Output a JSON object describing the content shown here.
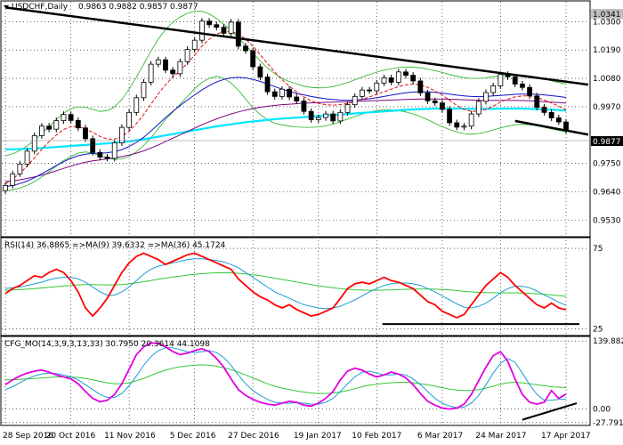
{
  "colors": {
    "candle_up": "#ffffff",
    "candle_down": "#000000",
    "bollinger": "#1db31d",
    "ma_red": "#e01010",
    "ma_blue": "#1010cc",
    "ma_purple": "#800080",
    "ma_cyan": "#00e5ff",
    "trendline": "#000000",
    "rsi_line": "#ff0000",
    "rsi_ma_fast": "#1e9bd6",
    "rsi_ma_slow": "#33c733",
    "cfg_main": "#e000e0",
    "cfg_signal1": "#1e9bd6",
    "cfg_signal2": "#33c733",
    "price_tag_bg": "#000000",
    "price_tag_fg": "#ffffff",
    "top_tag_bg": "#c0c0c0"
  },
  "header": {
    "symbol": "USDCHF,Daily",
    "ohlc": "0.9863 0.9882 0.9857 0.9877"
  },
  "price_axis": {
    "current_price": "0.9877",
    "top_marker": "1.0341",
    "ticks": [
      "1.0300",
      "1.0190",
      "1.0080",
      "0.9970",
      "0.9750",
      "0.9640",
      "0.9530"
    ]
  },
  "rsi_panel": {
    "label": "RSI(14) 36.8865 =>MA(9) 39.6332 =>MA(36) 45.1724",
    "ticks": [
      "75",
      "25"
    ]
  },
  "cfg_panel": {
    "label": "CFG_MO(14,3,9,3,13,33) 30.7950 20.3614 44.1098",
    "ticks": [
      "139.8827",
      "0.00",
      "-27.7916"
    ]
  },
  "time_axis": {
    "labels": [
      "28 Sep 2016",
      "20 Oct 2016",
      "11 Nov 2016",
      "5 Dec 2016",
      "27 Dec 2016",
      "19 Jan 2017",
      "10 Feb 2017",
      "6 Mar 2017",
      "24 Mar 2017",
      "17 Apr 2017"
    ]
  },
  "chart_data": [
    {
      "type": "candlestick",
      "title": "USDCHF,Daily",
      "ylim": [
        0.948,
        1.037
      ],
      "closes": [
        0.9665,
        0.971,
        0.9748,
        0.9798,
        0.9858,
        0.9895,
        0.9883,
        0.9916,
        0.994,
        0.9917,
        0.9888,
        0.9846,
        0.9793,
        0.9775,
        0.977,
        0.983,
        0.989,
        0.9948,
        1.0005,
        1.0065,
        1.0135,
        1.0152,
        1.0112,
        1.0098,
        1.0145,
        1.0192,
        1.0228,
        1.0302,
        1.0288,
        1.0278,
        1.0255,
        1.0298,
        1.0205,
        1.0187,
        1.0125,
        1.0085,
        1.0028,
        1.001,
        1.0038,
        1.0008,
        0.9992,
        0.9952,
        0.992,
        0.9928,
        0.9942,
        0.9915,
        0.9948,
        0.9978,
        1.001,
        1.0035,
        1.0032,
        1.0062,
        1.0082,
        1.0065,
        1.0105,
        1.0092,
        1.007,
        1.0024,
        0.9993,
        0.9985,
        0.996,
        0.9908,
        0.9891,
        0.9895,
        0.9942,
        0.9991,
        1.0025,
        1.0051,
        1.0095,
        1.0086,
        1.0058,
        1.0045,
        1.0012,
        0.9968,
        0.9948,
        0.9927,
        0.9911,
        0.9877
      ],
      "lower_band": [
        0.9645,
        0.9648,
        0.9655,
        0.9665,
        0.968,
        0.9698,
        0.9718,
        0.974,
        0.9762,
        0.9778,
        0.979,
        0.9795,
        0.979,
        0.978,
        0.977,
        0.9766,
        0.9768,
        0.9778,
        0.9795,
        0.982,
        0.985,
        0.9885,
        0.992,
        0.995,
        0.998,
        1.001,
        1.004,
        1.0065,
        1.008,
        1.0088,
        1.008,
        1.0062,
        1.0034,
        1.0,
        0.9966,
        0.994,
        0.992,
        0.9906,
        0.99,
        0.9895,
        0.9892,
        0.989,
        0.989,
        0.9892,
        0.9896,
        0.9903,
        0.9912,
        0.9922,
        0.9932,
        0.9942,
        0.995,
        0.9955,
        0.9958,
        0.9958,
        0.9955,
        0.995,
        0.9942,
        0.9932,
        0.992,
        0.9906,
        0.9893,
        0.9882,
        0.9872,
        0.9866,
        0.9864,
        0.9866,
        0.9872,
        0.988,
        0.9888,
        0.9895,
        0.99,
        0.9902,
        0.99,
        0.9896,
        0.989,
        0.9884,
        0.9878,
        0.9873
      ],
      "upper_band": [
        0.978,
        0.9788,
        0.98,
        0.9818,
        0.984,
        0.9866,
        0.9893,
        0.992,
        0.9945,
        0.9962,
        0.997,
        0.9968,
        0.996,
        0.9952,
        0.9955,
        0.997,
        0.9998,
        1.0038,
        1.0085,
        1.0135,
        1.0185,
        1.0232,
        1.027,
        1.0298,
        1.0318,
        1.0332,
        1.0341,
        1.034,
        1.033,
        1.0312,
        1.029,
        1.0265,
        1.0238,
        1.0208,
        1.0178,
        1.0148,
        1.012,
        1.0098,
        1.008,
        1.0068,
        1.0058,
        1.005,
        1.0045,
        1.0043,
        1.0044,
        1.0048,
        1.0055,
        1.0064,
        1.0074,
        1.0085,
        1.0095,
        1.0104,
        1.0112,
        1.0118,
        1.0122,
        1.0124,
        1.0124,
        1.0121,
        1.0116,
        1.011,
        1.0103,
        1.0095,
        1.0088,
        1.0083,
        1.008,
        1.008,
        1.0082,
        1.0086,
        1.009,
        1.0093,
        1.0094,
        1.0093,
        1.009,
        1.0085,
        1.0078,
        1.0071,
        1.0064,
        1.0058
      ],
      "ma_red": [
        0.967,
        0.969,
        0.9712,
        0.974,
        0.9772,
        0.9805,
        0.9835,
        0.986,
        0.9882,
        0.9893,
        0.9893,
        0.9885,
        0.987,
        0.9855,
        0.9845,
        0.9845,
        0.9855,
        0.9875,
        0.9905,
        0.994,
        0.998,
        1.002,
        1.0055,
        1.0085,
        1.011,
        1.0138,
        1.017,
        1.0205,
        1.0232,
        1.0252,
        1.0262,
        1.0262,
        1.0252,
        1.0232,
        1.0205,
        1.0172,
        1.0138,
        1.0105,
        1.0075,
        1.005,
        1.0028,
        1.0008,
        0.9993,
        0.9983,
        0.9978,
        0.9976,
        0.9978,
        0.9983,
        0.999,
        0.9998,
        1.0008,
        1.0018,
        1.0028,
        1.0038,
        1.0048,
        1.0055,
        1.0058,
        1.0055,
        1.0045,
        1.0032,
        1.0015,
        0.9995,
        0.9975,
        0.996,
        0.9952,
        0.9953,
        0.996,
        0.9972,
        0.9988,
        1.0,
        1.0008,
        1.0012,
        1.0012,
        1.0006,
        0.9996,
        0.9985,
        0.9972,
        0.9958
      ],
      "ma_blue": [
        0.966,
        0.9665,
        0.9672,
        0.9682,
        0.9695,
        0.971,
        0.9726,
        0.9742,
        0.9757,
        0.977,
        0.978,
        0.9786,
        0.9789,
        0.979,
        0.9792,
        0.9796,
        0.9804,
        0.9816,
        0.9832,
        0.9852,
        0.9876,
        0.9902,
        0.9928,
        0.9952,
        0.9975,
        0.9996,
        1.0016,
        1.0035,
        1.0052,
        1.0066,
        1.0076,
        1.0082,
        1.0084,
        1.0082,
        1.0076,
        1.0068,
        1.0058,
        1.0048,
        1.0038,
        1.003,
        1.0022,
        1.0016,
        1.001,
        1.0005,
        1.0001,
        0.9998,
        0.9996,
        0.9995,
        0.9996,
        0.9998,
        1.0001,
        1.0005,
        1.001,
        1.0015,
        1.002,
        1.0024,
        1.0027,
        1.0028,
        1.0028,
        1.0026,
        1.0023,
        1.0019,
        1.0015,
        1.0012,
        1.001,
        1.0009,
        1.001,
        1.0012,
        1.0014,
        1.0016,
        1.0018,
        1.0019,
        1.0019,
        1.0018,
        1.0016,
        1.0013,
        1.001,
        1.0006
      ],
      "ma_purple": [
        0.968,
        0.9683,
        0.9687,
        0.9692,
        0.9698,
        0.9705,
        0.9713,
        0.9722,
        0.9731,
        0.974,
        0.9748,
        0.9755,
        0.976,
        0.9764,
        0.9768,
        0.9772,
        0.9777,
        0.9783,
        0.979,
        0.9799,
        0.981,
        0.9822,
        0.9835,
        0.9848,
        0.9861,
        0.9874,
        0.9887,
        0.99,
        0.9912,
        0.9923,
        0.9933,
        0.9942,
        0.995,
        0.9957,
        0.9963,
        0.9968,
        0.9972,
        0.9975,
        0.9978,
        0.998,
        0.9982,
        0.9984,
        0.9985,
        0.9986,
        0.9987,
        0.9988,
        0.9989,
        0.999,
        0.9991,
        0.9992,
        0.9993,
        0.9994,
        0.9995,
        0.9996,
        0.9997,
        0.9998,
        0.9999,
        1.0,
        1.0,
        1.0,
        1.0,
        0.9999,
        0.9998,
        0.9997,
        0.9996,
        0.9995,
        0.9995,
        0.9995,
        0.9995,
        0.9995,
        0.9995,
        0.9994,
        0.9993,
        0.9992,
        0.999,
        0.9988,
        0.9986,
        0.9984
      ],
      "ma_cyan": [
        0.9805,
        0.9805,
        0.9806,
        0.9807,
        0.9808,
        0.981,
        0.9812,
        0.9814,
        0.9816,
        0.9818,
        0.982,
        0.9822,
        0.9824,
        0.9826,
        0.9828,
        0.983,
        0.9833,
        0.9836,
        0.984,
        0.9844,
        0.9849,
        0.9854,
        0.9859,
        0.9864,
        0.9869,
        0.9874,
        0.9879,
        0.9884,
        0.9889,
        0.9894,
        0.9898,
        0.9902,
        0.9906,
        0.991,
        0.9913,
        0.9916,
        0.9919,
        0.9922,
        0.9924,
        0.9926,
        0.9928,
        0.993,
        0.9932,
        0.9934,
        0.9936,
        0.9938,
        0.994,
        0.9942,
        0.9944,
        0.9946,
        0.9948,
        0.995,
        0.9952,
        0.9954,
        0.9956,
        0.9958,
        0.996,
        0.9961,
        0.9962,
        0.9963,
        0.9963,
        0.9963,
        0.9963,
        0.9962,
        0.9962,
        0.9962,
        0.9962,
        0.9962,
        0.9963,
        0.9963,
        0.9963,
        0.9963,
        0.9962,
        0.9961,
        0.996,
        0.9959,
        0.9957,
        0.9955
      ],
      "trendlines": [
        {
          "name": "resistance",
          "from": [
            0,
            1.0355
          ],
          "to": [
            77,
            1.0035
          ]
        },
        {
          "name": "support",
          "from": [
            70,
            0.9915
          ],
          "to": [
            77,
            0.9862
          ]
        }
      ]
    },
    {
      "type": "line",
      "title": "RSI(14) 36.8865 =>MA(9) 39.6332 =>MA(36) 45.1724",
      "ylim": [
        22,
        80
      ],
      "ticks": [
        75,
        25
      ],
      "series": [
        {
          "name": "RSI(14)",
          "values": [
            47,
            50,
            52,
            55,
            58,
            57,
            60,
            62,
            60,
            55,
            48,
            38,
            33,
            38,
            44,
            52,
            60,
            66,
            70,
            72,
            70,
            68,
            65,
            67,
            69,
            71,
            72,
            70,
            68,
            66,
            64,
            62,
            56,
            52,
            48,
            45,
            43,
            40,
            38,
            40,
            37,
            35,
            33,
            34,
            36,
            38,
            44,
            50,
            53,
            54,
            53,
            55,
            57,
            55,
            54,
            52,
            50,
            46,
            42,
            40,
            36,
            34,
            32,
            34,
            40,
            46,
            52,
            56,
            60,
            57,
            52,
            48,
            44,
            40,
            38,
            41,
            38,
            36.9
          ]
        },
        {
          "name": "MA(9)",
          "values": [
            50,
            50.5,
            51,
            52,
            53,
            54,
            55.5,
            56.5,
            57,
            57,
            56,
            54,
            51,
            48,
            46,
            46,
            48,
            51,
            55,
            59,
            62,
            64,
            65,
            66,
            67,
            68,
            68.5,
            68.5,
            68,
            67.5,
            66.5,
            65,
            63,
            60,
            57,
            54,
            51,
            48,
            46,
            44,
            42,
            40,
            39,
            38,
            37.5,
            38,
            39,
            41,
            43,
            45.5,
            48,
            50,
            52,
            53,
            53.5,
            53.5,
            53,
            52,
            50,
            48,
            45.5,
            43,
            40.5,
            38.5,
            38,
            39,
            41,
            44,
            47.5,
            50,
            51.5,
            51.5,
            50.5,
            48.5,
            46,
            44,
            41.5,
            39.6
          ]
        },
        {
          "name": "MA(36)",
          "values": [
            49,
            49.2,
            49.4,
            49.7,
            50,
            50.4,
            50.8,
            51.2,
            51.6,
            52,
            52.3,
            52.5,
            52.5,
            52.4,
            52.3,
            52.3,
            52.5,
            53,
            53.6,
            54.3,
            55,
            55.8,
            56.5,
            57.2,
            57.8,
            58.4,
            58.9,
            59.3,
            59.6,
            59.8,
            59.9,
            59.8,
            59.5,
            59.1,
            58.6,
            58,
            57.3,
            56.5,
            55.7,
            54.9,
            54.1,
            53.3,
            52.5,
            51.8,
            51.1,
            50.5,
            50,
            49.6,
            49.3,
            49.1,
            49,
            49,
            49.1,
            49.2,
            49.4,
            49.6,
            49.7,
            49.8,
            49.8,
            49.7,
            49.5,
            49.2,
            48.8,
            48.4,
            48,
            47.7,
            47.5,
            47.4,
            47.4,
            47.4,
            47.4,
            47.3,
            47.1,
            46.8,
            46.5,
            46.1,
            45.7,
            45.2
          ]
        }
      ],
      "support_line": {
        "from": [
          53,
          28
        ],
        "to": [
          77,
          28
        ]
      }
    },
    {
      "type": "line",
      "title": "CFG_MO(14,3,9,3,13,33) 30.7950 20.3614 44.1098",
      "ylim": [
        -30,
        142
      ],
      "ticks": [
        139.8827,
        0.0,
        -27.7916
      ],
      "series": [
        {
          "name": "CFG_MO main",
          "values": [
            50,
            60,
            68,
            74,
            78,
            80,
            76,
            70,
            66,
            62,
            52,
            36,
            22,
            15,
            18,
            30,
            52,
            82,
            112,
            128,
            136,
            135,
            128,
            118,
            112,
            115,
            120,
            124,
            118,
            104,
            86,
            62,
            40,
            28,
            20,
            14,
            10,
            8,
            12,
            16,
            14,
            8,
            6,
            12,
            22,
            36,
            60,
            78,
            84,
            80,
            72,
            66,
            70,
            76,
            72,
            64,
            50,
            32,
            16,
            8,
            2,
            0,
            2,
            10,
            30,
            58,
            86,
            110,
            118,
            98,
            62,
            30,
            14,
            10,
            14,
            38,
            22,
            30.8
          ]
        },
        {
          "name": "signal 1",
          "values": [
            40,
            46,
            54,
            62,
            68,
            72,
            74,
            73,
            70,
            66,
            60,
            50,
            40,
            30,
            24,
            24,
            32,
            48,
            68,
            90,
            108,
            120,
            126,
            126,
            122,
            118,
            116,
            118,
            120,
            116,
            106,
            90,
            70,
            52,
            38,
            28,
            20,
            14,
            12,
            12,
            13,
            12,
            10,
            10,
            14,
            22,
            36,
            52,
            66,
            76,
            78,
            74,
            70,
            70,
            72,
            70,
            62,
            50,
            36,
            22,
            12,
            6,
            3,
            4,
            12,
            28,
            50,
            74,
            94,
            104,
            96,
            74,
            50,
            30,
            18,
            18,
            20,
            20.4
          ]
        },
        {
          "name": "signal 2",
          "values": [
            60,
            60,
            61,
            62,
            63,
            64,
            65,
            66,
            66,
            66,
            65,
            63,
            60,
            57,
            54,
            52,
            52,
            54,
            58,
            63,
            69,
            75,
            80,
            84,
            87,
            89,
            90,
            91,
            90,
            88,
            85,
            81,
            76,
            70,
            64,
            58,
            52,
            47,
            43,
            40,
            37,
            35,
            33,
            32,
            32,
            33,
            35,
            38,
            42,
            46,
            49,
            51,
            53,
            54,
            55,
            55,
            54,
            52,
            50,
            47,
            44,
            41,
            39,
            38,
            38,
            40,
            43,
            47,
            51,
            54,
            55,
            54,
            52,
            50,
            48,
            46,
            45,
            44.1
          ]
        }
      ],
      "trendline": {
        "from": [
          71,
          -22
        ],
        "to": [
          77,
          12
        ]
      }
    }
  ]
}
